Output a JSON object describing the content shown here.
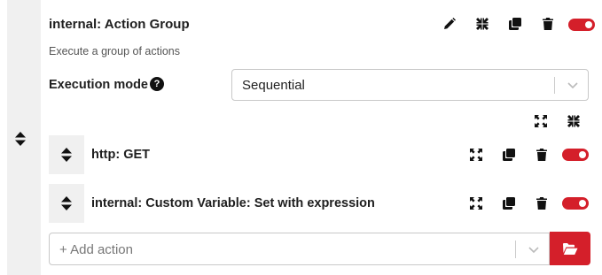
{
  "group": {
    "title": "internal: Action Group",
    "description": "Execute a group of actions",
    "execution_mode_label": "Execution mode",
    "help_glyph": "?",
    "execution_mode_value": "Sequential",
    "enabled": true
  },
  "actions": [
    {
      "label": "http: GET",
      "enabled": true
    },
    {
      "label": "internal: Custom Variable: Set with expression",
      "enabled": true
    }
  ],
  "add_action": {
    "placeholder": "+ Add action"
  },
  "colors": {
    "accent": "#d41f2a",
    "handle_bg": "#f0f0f0",
    "text": "#1f1f1f"
  },
  "icons": [
    "pencil-icon",
    "compress-icon",
    "duplicate-icon",
    "trash-icon",
    "expand-icon",
    "sort-handle-icon",
    "chevron-down-icon",
    "folder-open-icon"
  ]
}
